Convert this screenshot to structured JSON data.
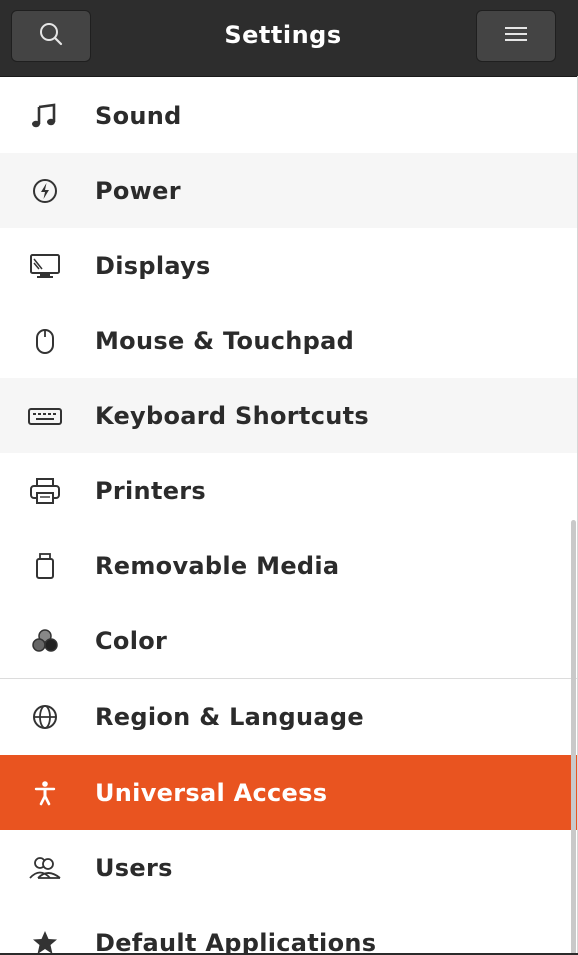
{
  "header": {
    "title": "Settings",
    "search_icon": "search-icon",
    "menu_icon": "hamburger-menu-icon"
  },
  "accent_color": "#e95420",
  "items": [
    {
      "label": "Sound",
      "icon": "music-note-icon"
    },
    {
      "label": "Power",
      "icon": "power-icon"
    },
    {
      "label": "Displays",
      "icon": "display-icon"
    },
    {
      "label": "Mouse & Touchpad",
      "icon": "mouse-icon"
    },
    {
      "label": "Keyboard Shortcuts",
      "icon": "keyboard-icon"
    },
    {
      "label": "Printers",
      "icon": "printer-icon"
    },
    {
      "label": "Removable Media",
      "icon": "removable-media-icon"
    },
    {
      "label": "Color",
      "icon": "color-icon"
    },
    {
      "label": "Region & Language",
      "icon": "globe-icon"
    },
    {
      "label": "Universal Access",
      "icon": "accessibility-icon",
      "selected": true
    },
    {
      "label": "Users",
      "icon": "users-icon"
    },
    {
      "label": "Default Applications",
      "icon": "star-icon"
    }
  ]
}
